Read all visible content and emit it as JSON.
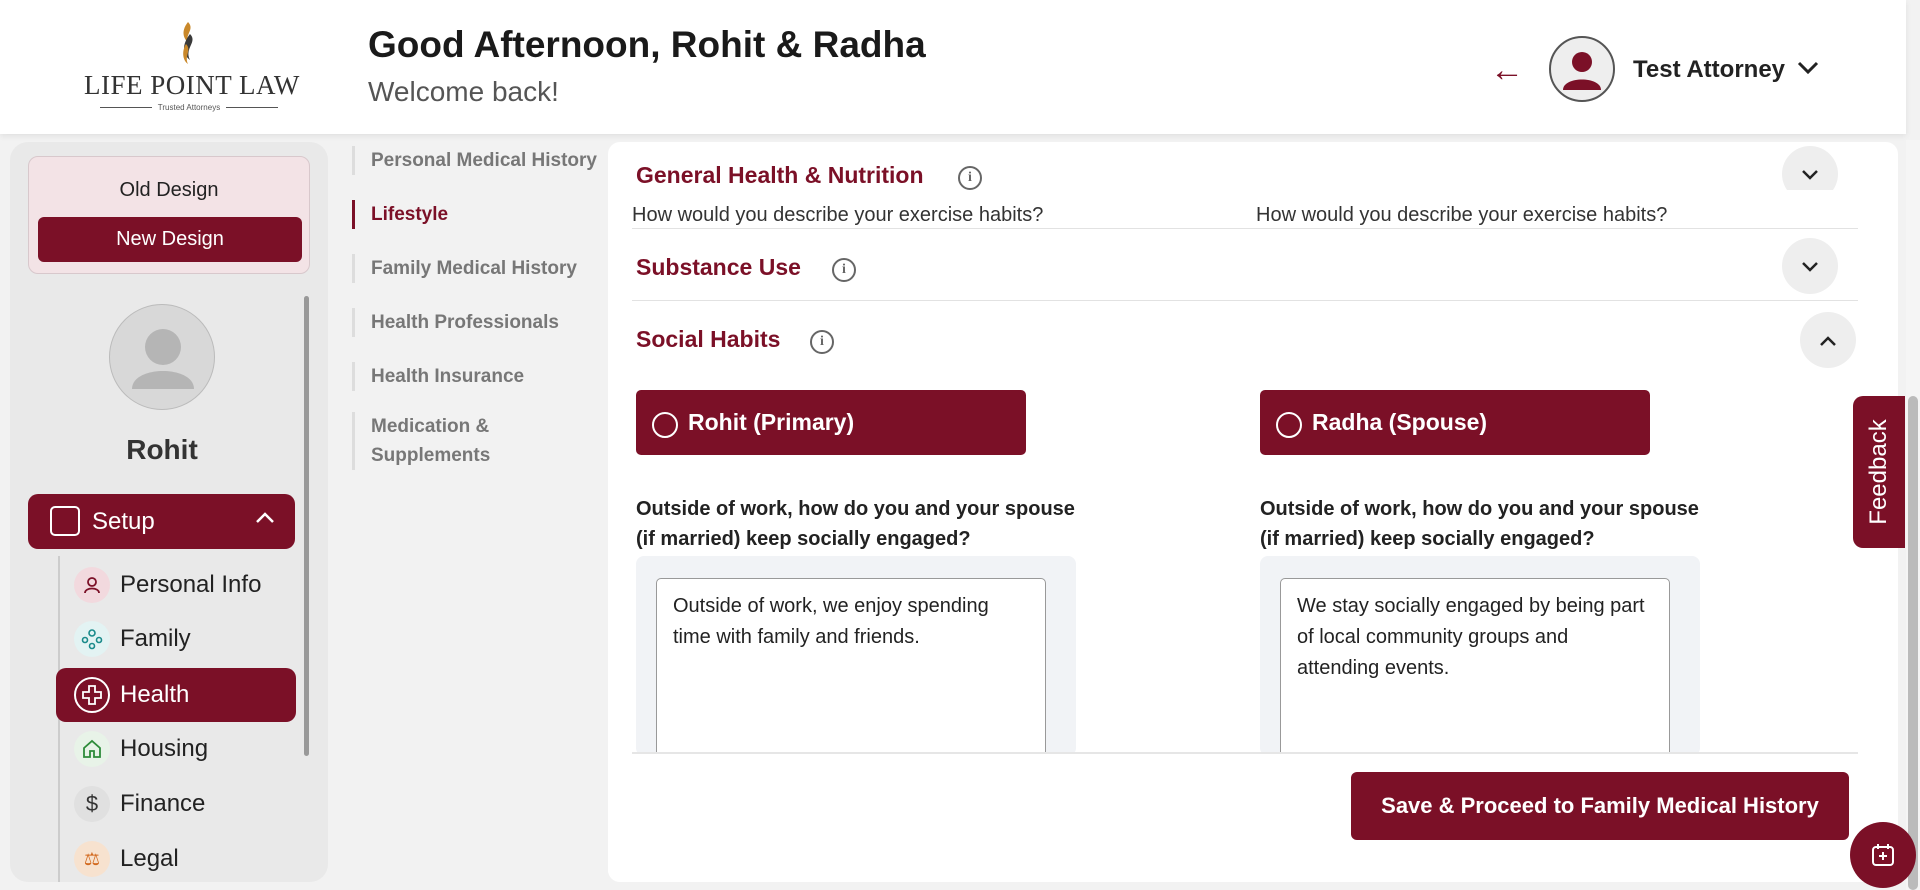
{
  "header": {
    "logo_text": "LIFE POINT LAW",
    "logo_tagline": "Trusted Attorneys",
    "greeting": "Good Afternoon, Rohit & Radha",
    "subtitle": "Welcome back!",
    "user_name": "Test Attorney"
  },
  "sidebar": {
    "old_design_label": "Old Design",
    "new_design_label": "New Design",
    "profile_name": "Rohit",
    "setup_label": "Setup",
    "items": [
      {
        "label": "Personal Info",
        "icon": "person-icon",
        "color": "#7b1027"
      },
      {
        "label": "Family",
        "icon": "family-icon",
        "color": "#1a8a8a"
      },
      {
        "label": "Health",
        "icon": "health-plus-icon",
        "color": "#ffffff"
      },
      {
        "label": "Housing",
        "icon": "house-icon",
        "color": "#2e8b3a"
      },
      {
        "label": "Finance",
        "icon": "dollar-icon",
        "color": "#333333"
      },
      {
        "label": "Legal",
        "icon": "legal-icon",
        "color": "#d2691e"
      }
    ],
    "active_item": "Health"
  },
  "subnav": {
    "items": [
      "Personal Medical History",
      "Lifestyle",
      "Family Medical History",
      "Health Professionals",
      "Health Insurance",
      "Medication & Supplements"
    ],
    "active": "Lifestyle"
  },
  "main": {
    "sections": [
      {
        "title": "General Health & Nutrition",
        "expanded": false
      },
      {
        "title": "Substance Use",
        "expanded": false
      },
      {
        "title": "Social Habits",
        "expanded": true
      }
    ],
    "clipped_question_left": "How would you describe your exercise habits?",
    "clipped_question_right": "How would you describe your exercise habits?",
    "primary_label": "Rohit (Primary)",
    "spouse_label": "Radha (Spouse)",
    "question_primary": "Outside of work, how do you and your spouse (if married) keep socially engaged?",
    "question_spouse": "Outside of work, how do you and your spouse (if married) keep socially engaged?",
    "answer_primary": "Outside of work, we enjoy spending time with family and friends.",
    "answer_spouse": "We stay socially engaged by being part of local community groups and attending events.",
    "save_button": "Save & Proceed to Family Medical History"
  },
  "feedback_label": "Feedback",
  "colors": {
    "brand": "#7b1027",
    "background": "#f2f2f2"
  }
}
